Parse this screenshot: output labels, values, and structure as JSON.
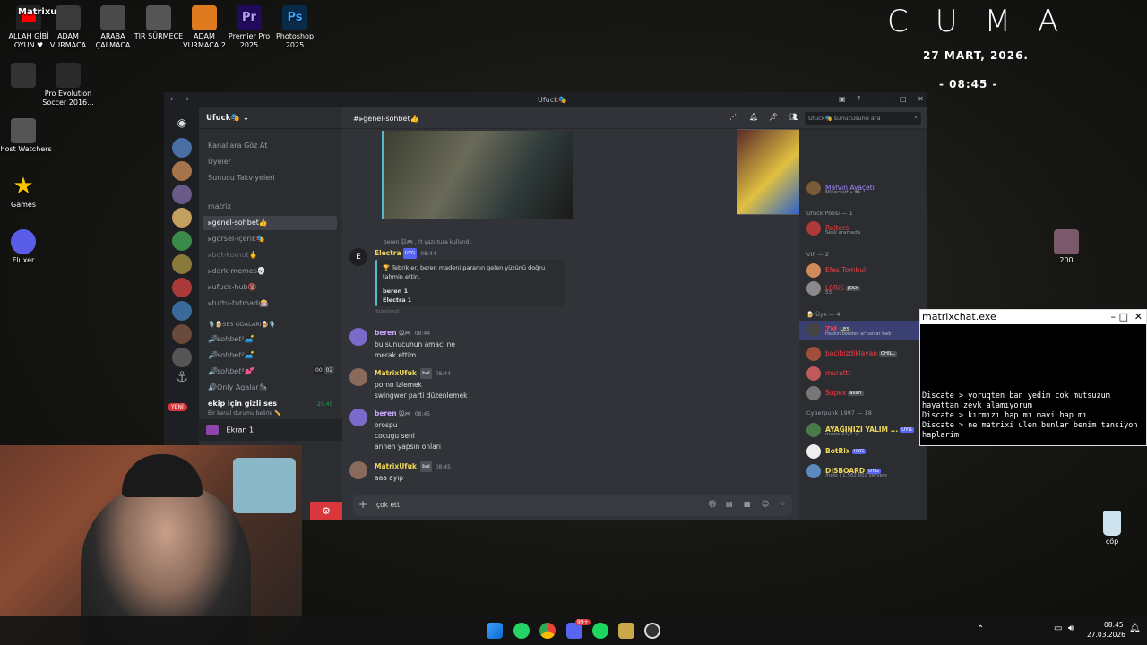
{
  "desktop": {
    "icons": [
      {
        "label": "ALLAH GİBİ OYUN ♥",
        "name": "allah-gibi-oyun-icon",
        "color": "#222"
      },
      {
        "label": "ADAM VURMACA",
        "name": "adam-vurmaca-icon",
        "color": "#333"
      },
      {
        "label": "ARABA ÇALMACA",
        "name": "gta-icon",
        "color": "#444"
      },
      {
        "label": "TIR SÜRMECE",
        "name": "truck-icon",
        "color": "#555"
      },
      {
        "label": "ADAM VURMACA 2",
        "name": "cs-icon",
        "color": "#e07a1f"
      },
      {
        "label": "Premier Pro 2025",
        "name": "premiere-icon",
        "color": "#1f0a5c"
      },
      {
        "label": "Photoshop 2025",
        "name": "photoshop-icon",
        "color": "#0a2a4a"
      },
      {
        "label": "",
        "name": "arc-raiders-icon",
        "color": "#333"
      },
      {
        "label": "Pro Evolution Soccer 2016...",
        "name": "pes-icon",
        "color": "#222"
      },
      {
        "label": "Ghost Watchers",
        "name": "ghost-watchers-icon",
        "color": "#555"
      },
      {
        "label": "Games",
        "name": "games-star-icon",
        "color": "#f5c400"
      },
      {
        "label": "Fluxer",
        "name": "fluxer-icon",
        "color": "#5a5de8"
      },
      {
        "label": "200",
        "name": "image-200-icon",
        "color": "#7a5a6a"
      },
      {
        "label": "çöp",
        "name": "recycle-bin-icon",
        "color": "#cfe3ee"
      }
    ],
    "channel_badge": "Matrixufuk"
  },
  "clock": {
    "day": "CUMA",
    "date": "27 MART, 2026.",
    "time": "- 08:45 -"
  },
  "discord": {
    "window_title": "Ufuck🎭",
    "server_name": "Ufuck🎭",
    "server_menu": [
      "Kanallara Göz At",
      "Üyeler",
      "Sunucu Takviyeleri"
    ],
    "category": "matrix",
    "channels": [
      "⫸genel-sohbet👍",
      "⫸görsel-içerik🎭",
      "⫸bot-komut🖕",
      "⫸dark-memes💀",
      "⫸ufuck-hub🔞",
      "⫸tuttu-tutmadı🎰"
    ],
    "voice_category": "🎙️🍺SES ODALARI🍺🎙️",
    "voice_channels": [
      "🔊sohbet¹🛋️",
      "🔊sohbet²🛋️",
      "🔊sohbet³💕",
      "🔊Only Agalar🦍"
    ],
    "voice_counter": [
      "00",
      "02"
    ],
    "hidden_voice": "ekip için gizli ses",
    "hidden_voice_sub": "Bir kanal durumu belirle ✏️",
    "hidden_voice_time": "29:45",
    "screen_label": "Ekran 1",
    "new_badge": "YENİ",
    "chat_channel": "#⫸genel-sohbet👍",
    "search_placeholder": "Ufuck🎭 sunucusunu ara",
    "system_line": "beren 🐭🎮 , !t yazı-tura kullandı.",
    "bot_name": "Electra",
    "bot_badge": "UYG",
    "bot_time": "08:44",
    "bot_embed_title": "🏆 Tebrikler, beren madeni paranın gelen yüzünü doğru tahmin ettin.",
    "bot_embed_lines": [
      "beren 1",
      "Electra 1"
    ],
    "bot_footer": "düzenlendi",
    "messages": [
      {
        "user": "beren",
        "tag": "🐭🎮",
        "time": "08:44",
        "lines": [
          "bu sunucunun amacı ne",
          "merak ettim"
        ],
        "color": "#c9a7ff"
      },
      {
        "user": "MatrixUfuk",
        "tag": "bal",
        "time": "08:44",
        "lines": [
          "porno izlemek",
          "swingwer parti düzenlemek"
        ],
        "color": "#f0d85a"
      },
      {
        "user": "beren",
        "tag": "🐭🎮",
        "time": "08:45",
        "lines": [
          "orospu",
          "cocugu seni",
          "annen yapsın onları"
        ],
        "color": "#c9a7ff"
      },
      {
        "user": "MatrixUfuk",
        "tag": "bal",
        "time": "08:45",
        "lines": [
          "aaa ayıp"
        ],
        "color": "#f0d85a"
      }
    ],
    "composer_value": "çok ett",
    "members": {
      "top_member": {
        "name": "Mafvin Ayaçeti",
        "status": "Minecraft • 🎮"
      },
      "group1": "Ufuck Polisi — 1",
      "group1_members": [
        {
          "name": "Reiters",
          "status": "Sesli aramada",
          "color": "#f23f43"
        }
      ],
      "group2": "VIP — 2",
      "group2_members": [
        {
          "name": "Efes Tombul",
          "status": "",
          "color": "#f23f43"
        },
        {
          "name": "L0RiS",
          "status": "53",
          "color": "#f23f43",
          "badge": "JOLY"
        }
      ],
      "group3": "🍺 Üye — 4",
      "group3_members": [
        {
          "name": "ZM",
          "status": "Hakkın benden ar'banlar kadı",
          "color": "#f23f43",
          "badge": "LES"
        },
        {
          "name": "bacibizdiklayan",
          "status": "",
          "color": "#f23f43",
          "badge": "CHILL"
        },
        {
          "name": "murattt",
          "status": "",
          "color": "#f23f43"
        },
        {
          "name": "Supex",
          "status": "",
          "color": "#f23f43",
          "badge": "allah"
        }
      ],
      "group4": "Cyberpunk 1997 — 18",
      "group4_members": [
        {
          "name": "AYAĞINIZI YALIM ...",
          "status": "music 24/7 🎶",
          "color": "#f0d85a",
          "badge": "UYG"
        },
        {
          "name": "BotRix",
          "status": "",
          "color": "#f0d85a",
          "badge": "UYG"
        },
        {
          "name": "DISBOARD",
          "status": "/help | 1,562,002 servers",
          "color": "#f0d85a",
          "badge": "UYG"
        }
      ]
    }
  },
  "matrixchat": {
    "title": "matrixchat.exe",
    "lines": [
      "Discate > yoruqten ban yedim cok mutsuzum hayattan zevk alamıyorum",
      "Discate > kırmızı hap mı mavi hap mı",
      "Discate > ne matrixi ulen bunlar benim tansiyon hapları̇m"
    ]
  },
  "taskbar": {
    "time": "08:45",
    "date": "27.03.2026",
    "discord_badge": "99+"
  }
}
